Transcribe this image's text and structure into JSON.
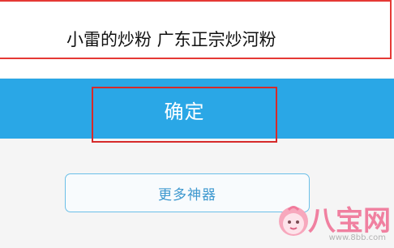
{
  "search": {
    "value": "小雷的炒粉 广东正宗炒河粉"
  },
  "actions": {
    "confirm_label": "确定",
    "more_label": "更多神器"
  },
  "watermark": {
    "brand": "八宝网",
    "url": "www.8bb.com"
  },
  "colors": {
    "highlight": "#e53935",
    "primary": "#2aa7e6",
    "outline": "#6bbfe8",
    "watermark": "#f07a9c"
  }
}
